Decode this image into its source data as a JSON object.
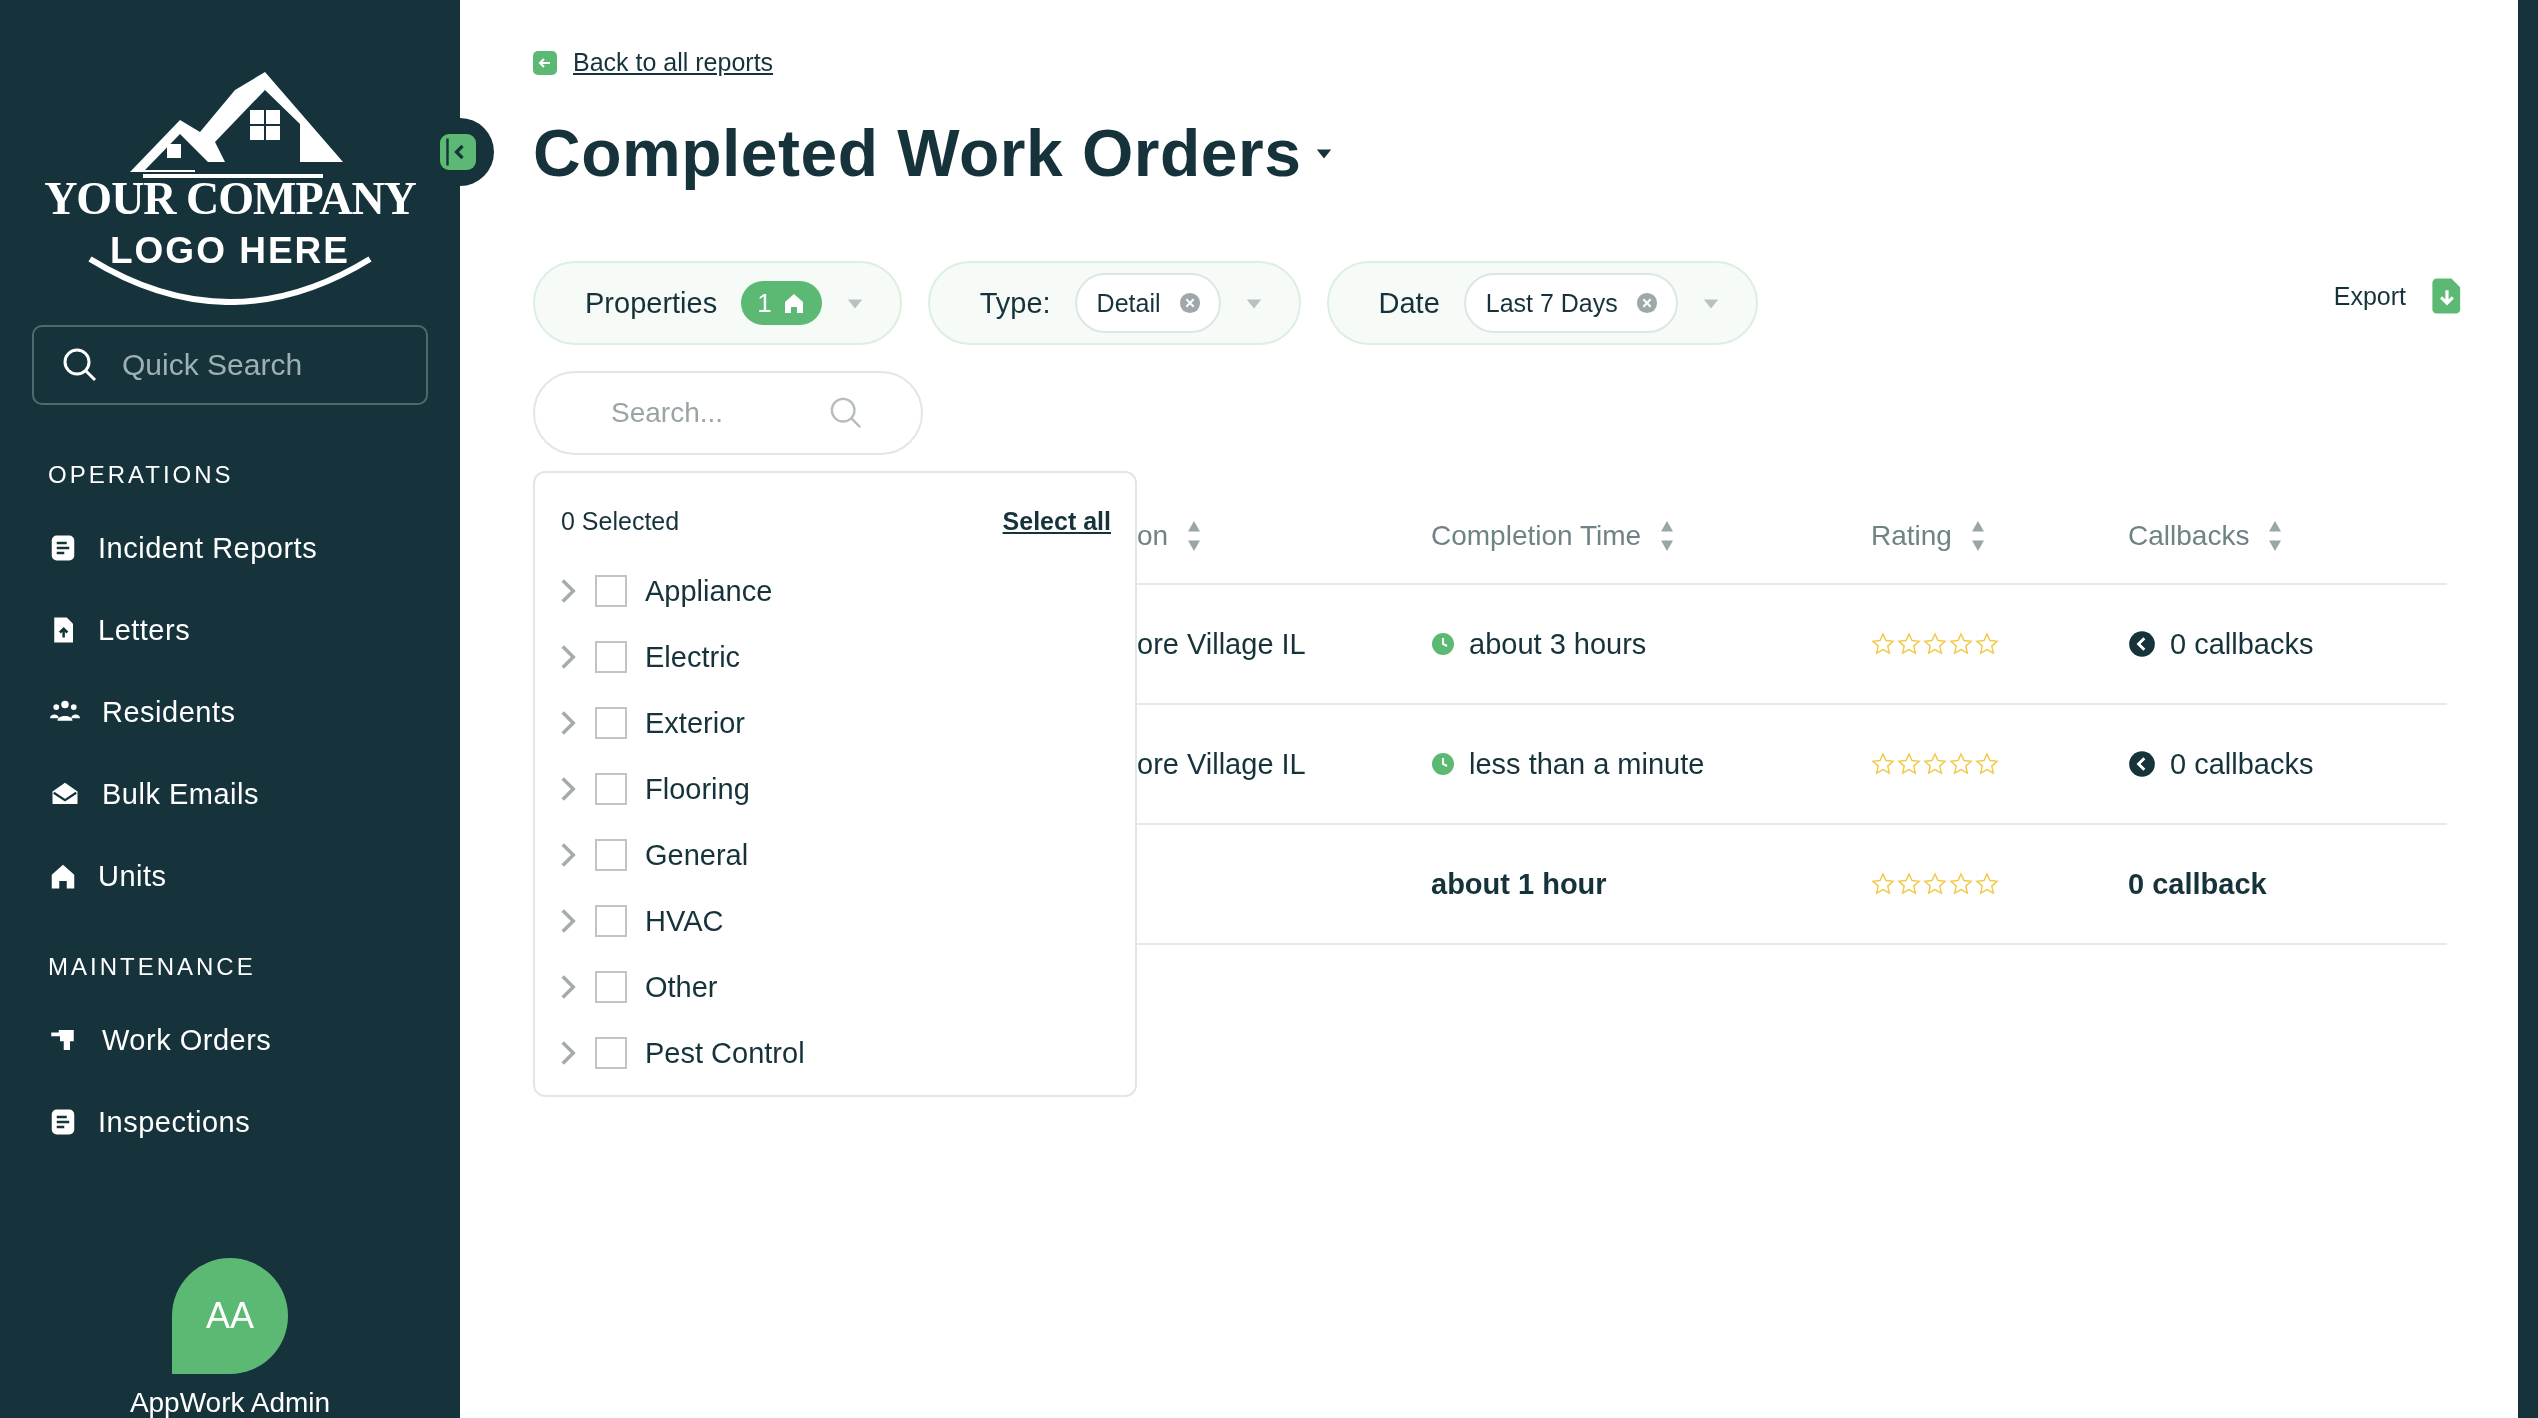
{
  "logo": {
    "line_1": "YOUR COMPANY",
    "line_2": "LOGO HERE"
  },
  "quick_search": {
    "placeholder": "Quick Search"
  },
  "sidebar": {
    "sections": [
      {
        "title": "OPERATIONS",
        "items": [
          {
            "label": "Incident Reports"
          },
          {
            "label": "Letters"
          },
          {
            "label": "Residents"
          },
          {
            "label": "Bulk Emails"
          },
          {
            "label": "Units"
          }
        ]
      },
      {
        "title": "MAINTENANCE",
        "items": [
          {
            "label": "Work Orders"
          },
          {
            "label": "Inspections"
          }
        ]
      }
    ]
  },
  "user": {
    "initials": "AA",
    "name": "AppWork Admin"
  },
  "back_link": "Back to all reports",
  "title": "Completed Work Orders",
  "filters": [
    {
      "kind": "count",
      "label": "Properties",
      "count": "1"
    },
    {
      "kind": "chip",
      "label": "Type:",
      "value": "Detail"
    },
    {
      "kind": "chip",
      "label": "Date",
      "value": "Last 7 Days"
    }
  ],
  "export": "Export",
  "search": {
    "placeholder": "Search..."
  },
  "dropdown": {
    "summary": "0 Selected",
    "select_all": "Select all",
    "options": [
      {
        "label": "Appliance",
        "checked": false,
        "expanded": false
      },
      {
        "label": "Electric",
        "checked": false,
        "expanded": false
      },
      {
        "label": "Exterior",
        "checked": false,
        "expanded": false
      },
      {
        "label": "Flooring",
        "checked": false,
        "expanded": false
      },
      {
        "label": "General",
        "checked": false,
        "expanded": false
      },
      {
        "label": "HVAC",
        "checked": false,
        "expanded": false
      },
      {
        "label": "Other",
        "checked": false,
        "expanded": false
      },
      {
        "label": "Pest Control",
        "checked": false,
        "expanded": false
      }
    ]
  },
  "table": {
    "columns": [
      "on",
      "Completion Time",
      "Rating",
      "Callbacks"
    ],
    "rows": [
      {
        "kind": "data",
        "column_1": "ore Village IL",
        "completion": "about 3 hours",
        "stars": 0,
        "callbacks": "0 callbacks"
      },
      {
        "kind": "data",
        "column_1": "ore Village IL",
        "completion": "less than a minute",
        "stars": 0,
        "callbacks": "0 callbacks"
      },
      {
        "kind": "total",
        "completion": "about 1 hour",
        "stars": 0,
        "callbacks": "0 callback"
      }
    ]
  }
}
